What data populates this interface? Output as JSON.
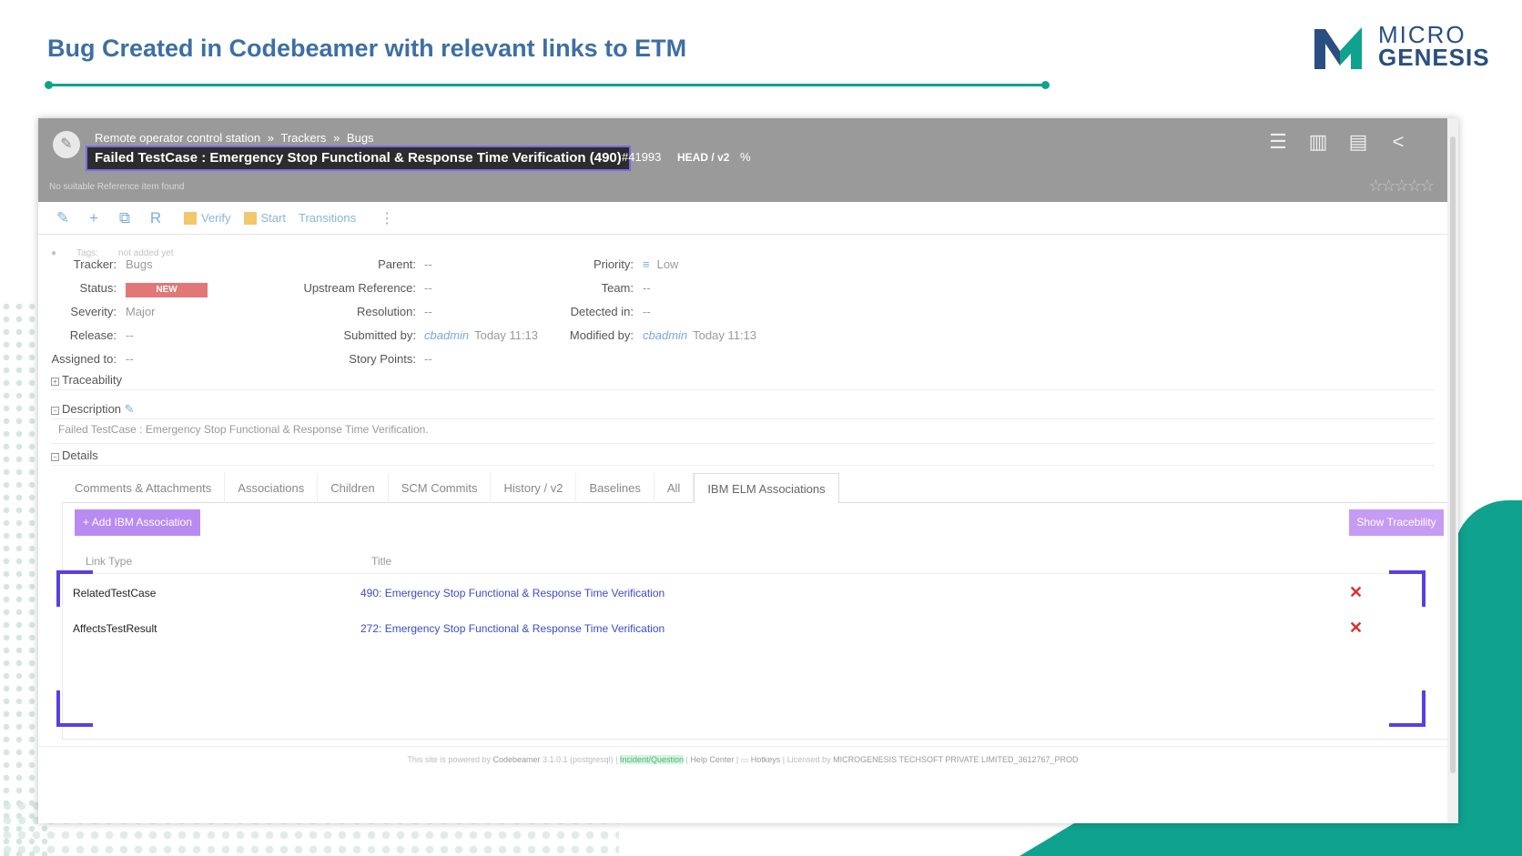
{
  "slide": {
    "title": "Bug Created in Codebeamer with relevant links to ETM",
    "logo_line1": "MICRO",
    "logo_line2": "GENESIS"
  },
  "header": {
    "breadcrumb": [
      "Remote operator control station",
      "»",
      "Trackers",
      "»",
      "Bugs"
    ],
    "item_title": "Failed TestCase : Emergency Stop Functional & Response Time Verification (490)",
    "item_id": "#41993",
    "version": "HEAD / v2",
    "link_symbol": "%",
    "no_reference": "No suitable Reference item found",
    "stars": "☆☆☆☆☆"
  },
  "toolbar": {
    "verify_label": "Verify",
    "start_label": "Start",
    "transitions_label": "Transitions"
  },
  "tags": {
    "label": "Tags:",
    "value": "not added yet"
  },
  "fields": {
    "tracker": {
      "label": "Tracker:",
      "value": "Bugs"
    },
    "status": {
      "label": "Status:",
      "value": "NEW"
    },
    "severity": {
      "label": "Severity:",
      "value": "Major"
    },
    "release": {
      "label": "Release:",
      "value": "--"
    },
    "assigned": {
      "label": "Assigned to:",
      "value": "--"
    },
    "parent": {
      "label": "Parent:",
      "value": "--"
    },
    "upstream": {
      "label": "Upstream Reference:",
      "value": "--"
    },
    "resolution": {
      "label": "Resolution:",
      "value": "--"
    },
    "submitted": {
      "label": "Submitted by:",
      "user": "cbadmin",
      "time": "Today 11:13"
    },
    "story_points": {
      "label": "Story Points:",
      "value": "--"
    },
    "priority": {
      "label": "Priority:",
      "value": "Low",
      "symbol": "≡"
    },
    "team": {
      "label": "Team:",
      "value": "--"
    },
    "detected": {
      "label": "Detected in:",
      "value": "--"
    },
    "modified": {
      "label": "Modified by:",
      "user": "cbadmin",
      "time": "Today 11:13"
    }
  },
  "sections": {
    "traceability": "Traceability",
    "description": "Description",
    "description_text": "Failed TestCase : Emergency Stop Functional & Response Time Verification.",
    "details": "Details"
  },
  "tabs": [
    "Comments & Attachments",
    "Associations",
    "Children",
    "SCM Commits",
    "History / v2",
    "Baselines",
    "All",
    "IBM ELM Associations"
  ],
  "associations": {
    "add_button": "+ Add IBM Association",
    "trace_button": "Show Tracebility",
    "col_link_type": "Link Type",
    "col_title": "Title",
    "rows": [
      {
        "type": "RelatedTestCase",
        "title": "490: Emergency Stop Functional & Response Time Verification"
      },
      {
        "type": "AffectsTestResult",
        "title": "272: Emergency Stop Functional & Response Time Verification"
      }
    ],
    "delete_symbol": "✕"
  },
  "footer": {
    "powered": "This site is powered by",
    "product": "Codebeamer",
    "version": "3.1.0.1 (postgresql)",
    "incident": "Incident/Question",
    "help": "Help Center",
    "hotkeys": "Hotkeys",
    "license": "Licensed by",
    "licensee": "MICROGENESIS TECHSOFT PRIVATE LIMITED_3612767_PROD"
  },
  "colors": {
    "accent": "#0fa28e",
    "title": "#3d6fa4",
    "badge": "#e27777",
    "purple": "#b98bf2",
    "frame": "#5b3fe0"
  }
}
